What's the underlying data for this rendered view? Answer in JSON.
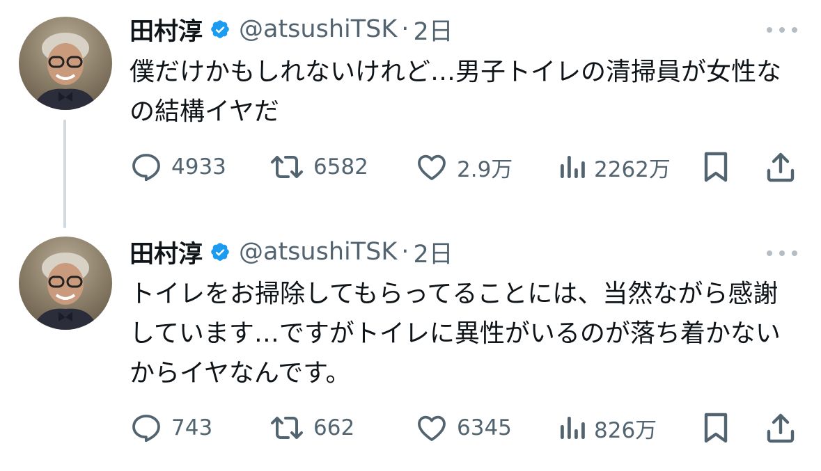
{
  "colors": {
    "text": "#0f1419",
    "muted": "#536471",
    "icon": "#536471",
    "verified": "#1d9bf0",
    "thread_line": "#cfd9de"
  },
  "icons": {
    "reply": "speech-bubble-icon",
    "retweet": "retweet-arrows-icon",
    "like": "heart-icon",
    "views": "bar-chart-icon",
    "bookmark": "bookmark-icon",
    "share": "share-upload-icon",
    "verified": "verified-badge-icon",
    "more": "more-dots-icon"
  },
  "tweets": [
    {
      "name": "田村淳",
      "handle": "@atsushiTSK",
      "separator": "·",
      "time": "2日",
      "text": "僕だけかもしれないけれど…男子トイレの清掃員が女性なの結構イヤだ",
      "replies": "4933",
      "retweets": "6582",
      "likes": "2.9万",
      "views": "2262万"
    },
    {
      "name": "田村淳",
      "handle": "@atsushiTSK",
      "separator": "·",
      "time": "2日",
      "text": "トイレをお掃除してもらってることには、当然ながら感謝しています…ですがトイレに異性がいるのが落ち着かないからイヤなんです。",
      "replies": "743",
      "retweets": "662",
      "likes": "6345",
      "views": "826万"
    }
  ]
}
